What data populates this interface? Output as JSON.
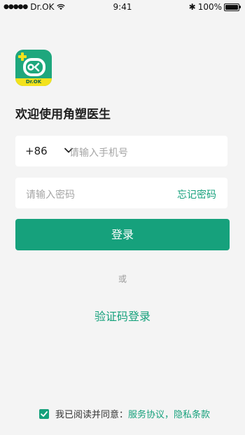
{
  "status_bar": {
    "carrier": "Dr.OK",
    "time": "9:41",
    "battery": "100%"
  },
  "logo": {
    "strip_text": "Dr.OK"
  },
  "welcome": "欢迎使用角塑医生",
  "phone": {
    "country_code": "+86",
    "placeholder": "请输入手机号"
  },
  "password": {
    "placeholder": "请输入密码",
    "forgot_label": "忘记密码"
  },
  "login_label": "登录",
  "or_text": "或",
  "code_login_label": "验证码登录",
  "agreement": {
    "prefix": "我已阅读并同意：",
    "service": "服务协议",
    "separator": "，",
    "privacy": "隐私条款",
    "checked": true
  },
  "colors": {
    "accent": "#16a17c",
    "logo_yellow": "#f3e21c"
  }
}
